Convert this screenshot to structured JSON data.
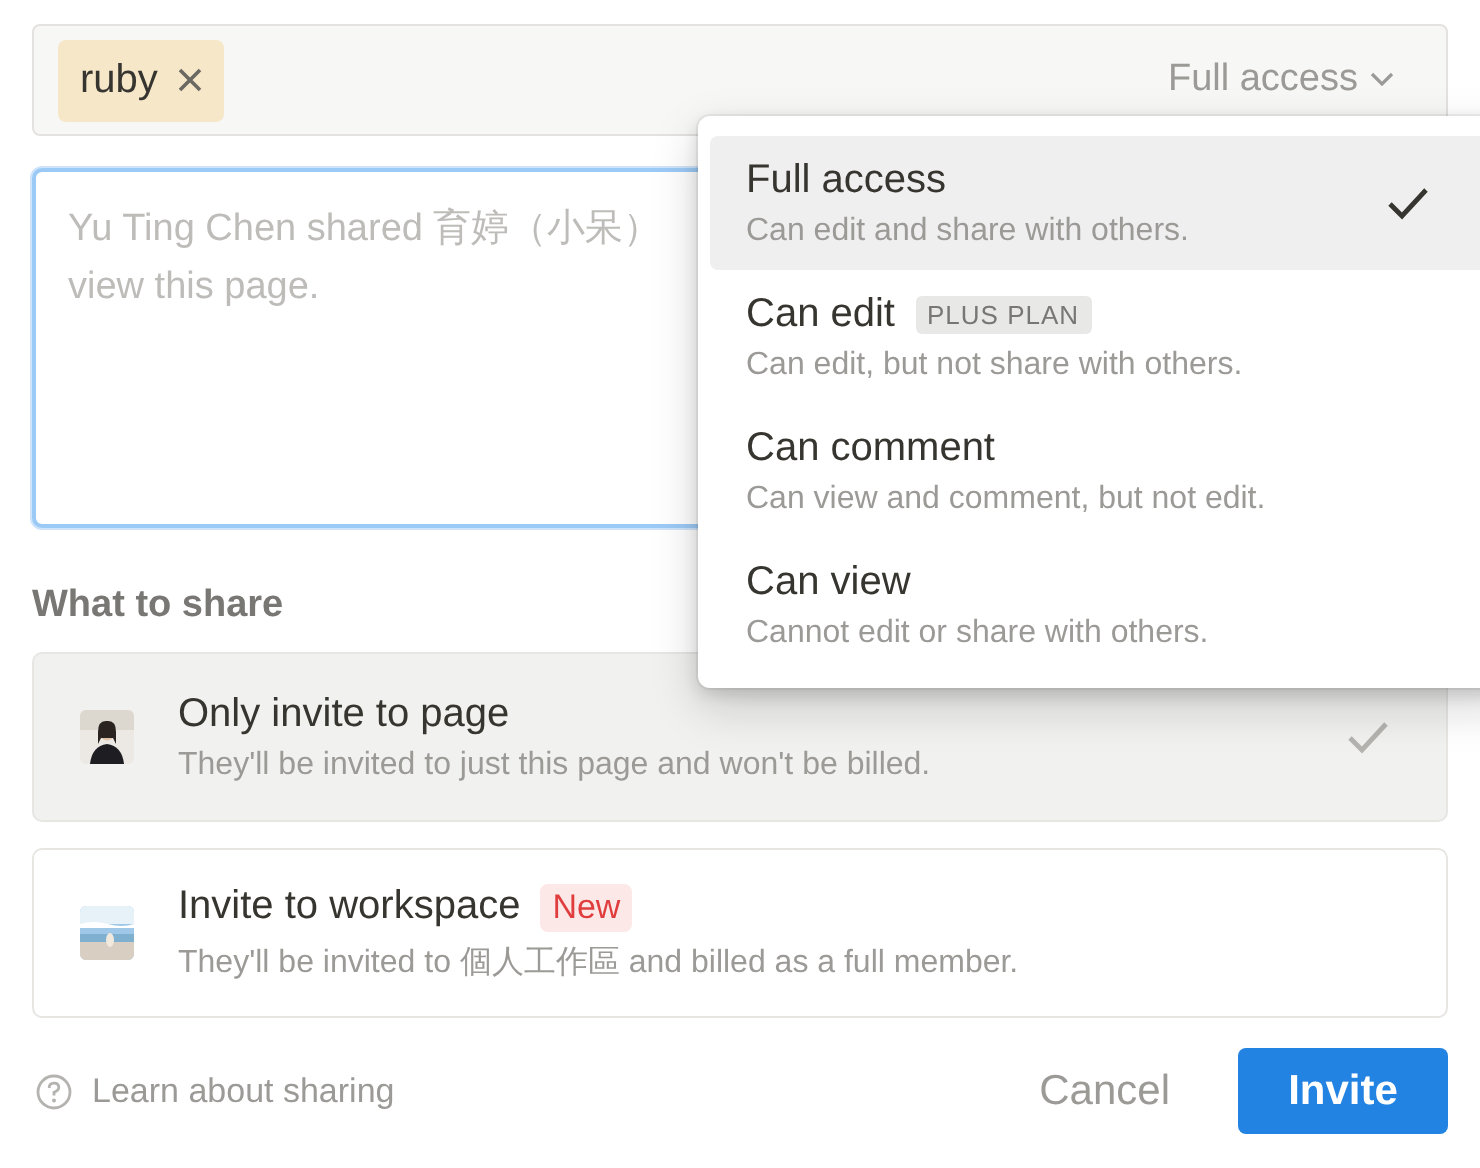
{
  "invite_bar": {
    "invitees": [
      {
        "name": "ruby"
      }
    ],
    "access_dropdown": {
      "label": "Full access"
    }
  },
  "message": {
    "placeholder": "Yu Ting Chen shared 育婷（小呆）\nview this page."
  },
  "what_to_share": {
    "heading": "What to share",
    "options": [
      {
        "title": "Only invite to page",
        "description": "They'll be invited to just this page and won't be billed.",
        "selected": true
      },
      {
        "title": "Invite to workspace",
        "badge": "New",
        "description": "They'll be invited to 個人工作區 and billed as a full member.",
        "selected": false
      }
    ]
  },
  "footer": {
    "help_link": "Learn about sharing",
    "buttons": [
      {
        "label": "Cancel",
        "kind": "secondary"
      },
      {
        "label": "Invite",
        "kind": "primary"
      }
    ]
  },
  "access_menu": {
    "items": [
      {
        "title": "Full access",
        "description": "Can edit and share with others.",
        "selected": true
      },
      {
        "title": "Can edit",
        "badge": "PLUS PLAN",
        "description": "Can edit, but not share with others.",
        "selected": false
      },
      {
        "title": "Can comment",
        "description": "Can view and comment, but not edit.",
        "selected": false
      },
      {
        "title": "Can view",
        "description": "Cannot edit or share with others.",
        "selected": false
      }
    ]
  }
}
